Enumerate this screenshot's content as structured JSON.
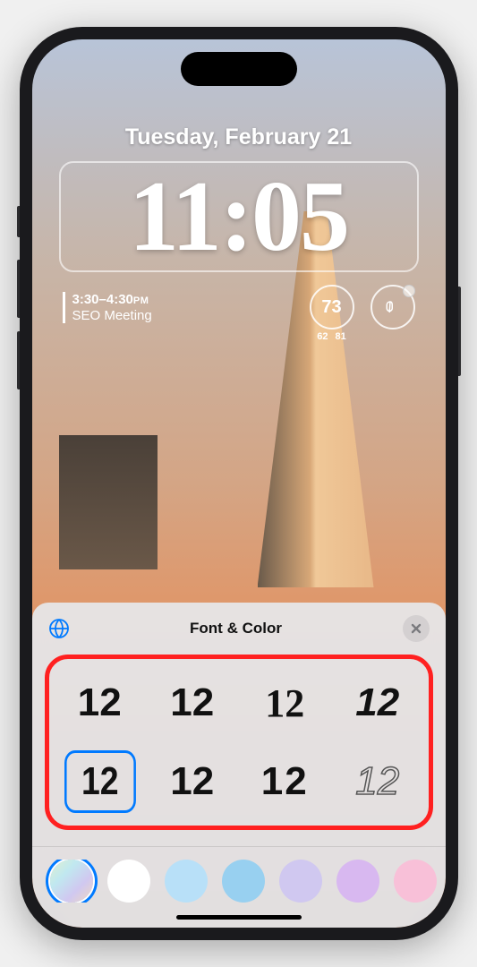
{
  "lockscreen": {
    "date": "Tuesday, February 21",
    "time": "11:05",
    "calendar": {
      "time_range": "3:30–4:30",
      "ampm": "PM",
      "title": "SEO Meeting"
    },
    "weather": {
      "temp": "73",
      "low": "62",
      "high": "81"
    }
  },
  "panel": {
    "title": "Font & Color",
    "font_sample": "12",
    "font_options": [
      {
        "style": "sf",
        "selected": false
      },
      {
        "style": "sf-rounded",
        "selected": false
      },
      {
        "style": "ny",
        "selected": false
      },
      {
        "style": "stencil",
        "selected": false
      },
      {
        "style": "sf-cond",
        "selected": true
      },
      {
        "style": "slab",
        "selected": false
      },
      {
        "style": "wide",
        "selected": false
      },
      {
        "style": "outline",
        "selected": false
      }
    ],
    "colors": [
      {
        "name": "iridescent",
        "css": "linear-gradient(135deg,#e0f0d0,#c0e8f0,#d0c8f0,#f0d8c0)",
        "selected": true
      },
      {
        "name": "white",
        "css": "#ffffff",
        "selected": false
      },
      {
        "name": "light-blue",
        "css": "#b8e0f8",
        "selected": false
      },
      {
        "name": "sky-blue",
        "css": "#98d0f0",
        "selected": false
      },
      {
        "name": "lavender",
        "css": "#d0c8f0",
        "selected": false
      },
      {
        "name": "purple",
        "css": "#d8b8f0",
        "selected": false
      },
      {
        "name": "pink",
        "css": "#f8c0d8",
        "selected": false
      }
    ]
  }
}
